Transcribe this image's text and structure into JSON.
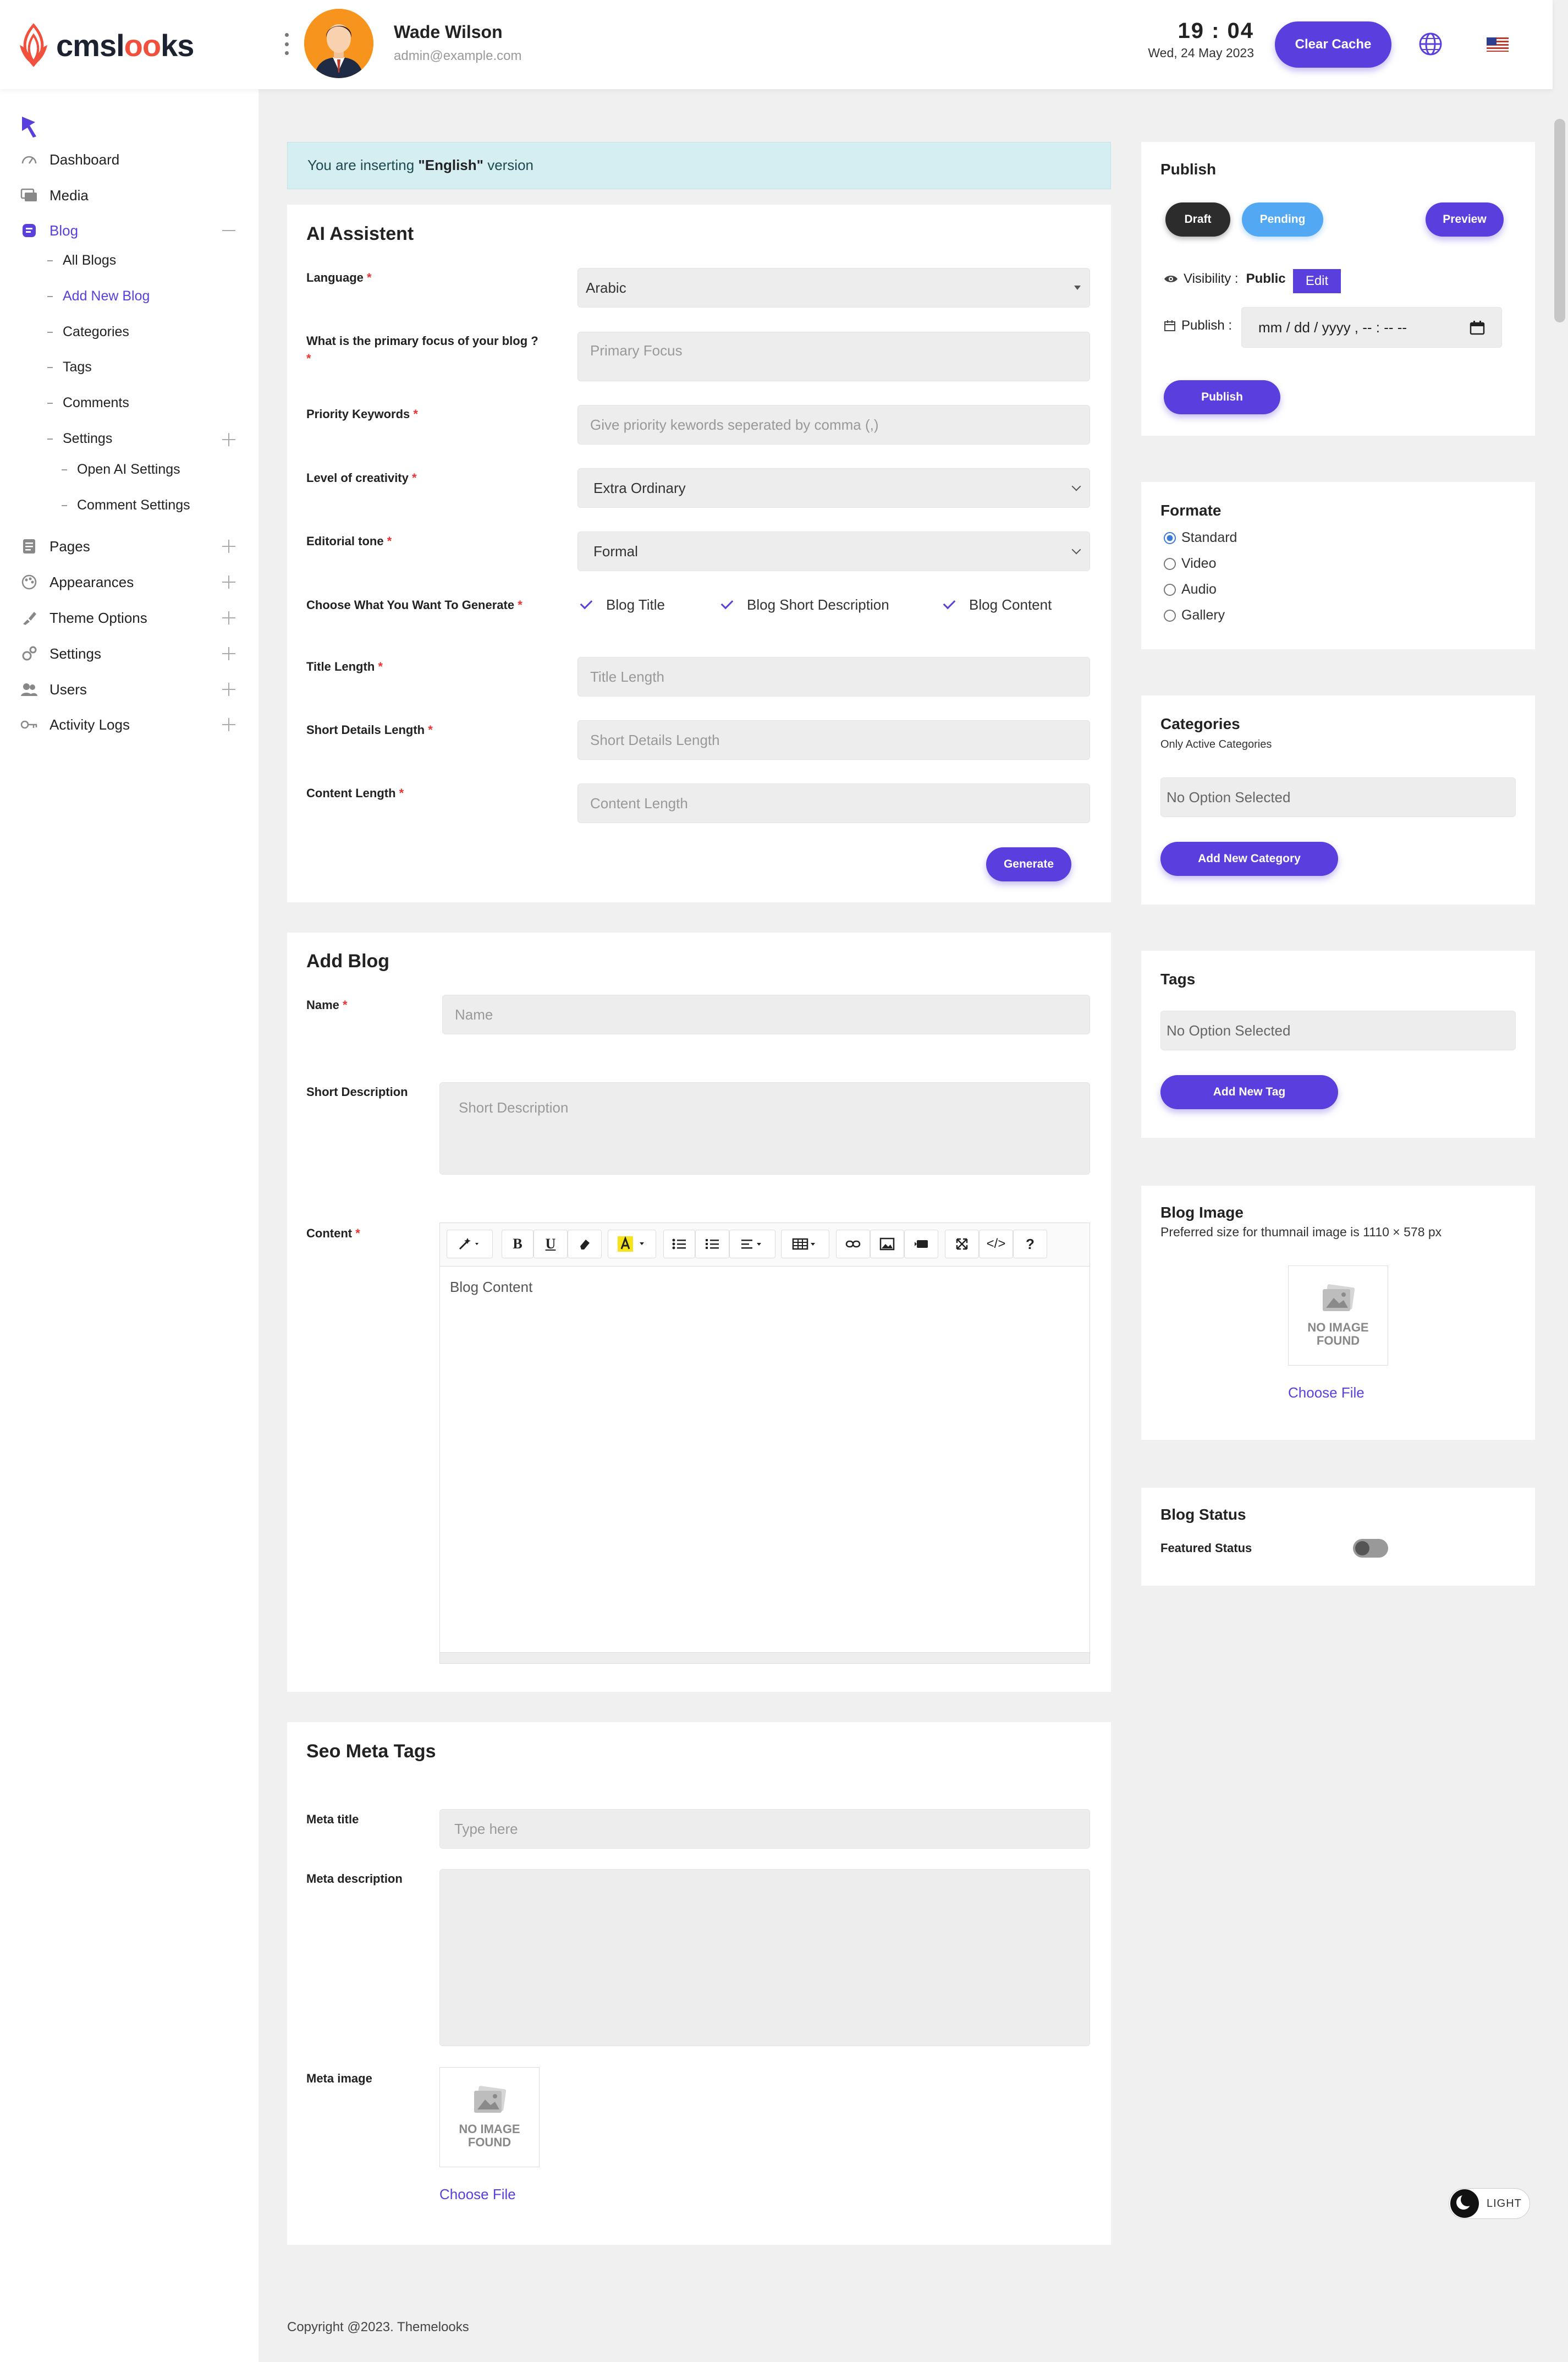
{
  "header": {
    "logo_prefix": "cmsl",
    "logo_oo": "oo",
    "logo_suffix": "ks",
    "user_name": "Wade Wilson",
    "user_email": "admin@example.com",
    "time": "19 : 04",
    "date": "Wed, 24 May 2023",
    "clear_cache_label": "Clear Cache",
    "globe_icon": "globe-icon",
    "flag_icon": "us-flag-icon"
  },
  "sidebar": {
    "items": [
      {
        "label": "Dashboard",
        "icon": "dashboard-icon"
      },
      {
        "label": "Media",
        "icon": "media-icon"
      },
      {
        "label": "Blog",
        "icon": "blog-icon"
      },
      {
        "label": "Pages",
        "icon": "pages-icon"
      },
      {
        "label": "Appearances",
        "icon": "appearances-icon"
      },
      {
        "label": "Theme Options",
        "icon": "theme-options-icon"
      },
      {
        "label": "Settings",
        "icon": "settings-icon"
      },
      {
        "label": "Users",
        "icon": "users-icon"
      },
      {
        "label": "Activity Logs",
        "icon": "activity-logs-icon"
      }
    ],
    "blog_sub": [
      "All Blogs",
      "Add New Blog",
      "Categories",
      "Tags",
      "Comments",
      "Settings"
    ],
    "settings_sub": [
      "Open AI Settings",
      "Comment Settings"
    ]
  },
  "notice": {
    "prefix": "You are inserting ",
    "lang": "\"English\"",
    "suffix": " version"
  },
  "ai": {
    "title": "AI Assistent",
    "language_label": "Language",
    "language_value": "Arabic",
    "focus_label": "What is the primary focus of your blog ?",
    "focus_placeholder": "Primary Focus",
    "keywords_label": "Priority Keywords",
    "keywords_placeholder": "Give priority kewords seperated by comma (,)",
    "creativity_label": "Level of creativity",
    "creativity_value": "Extra Ordinary",
    "tone_label": "Editorial tone",
    "tone_value": "Formal",
    "generate_what_label": "Choose What You Want To Generate",
    "checks": [
      "Blog Title",
      "Blog Short Description",
      "Blog Content"
    ],
    "title_length_label": "Title Length",
    "title_length_placeholder": "Title Length",
    "short_length_label": "Short Details Length",
    "short_length_placeholder": "Short Details Length",
    "content_length_label": "Content Length",
    "content_length_placeholder": "Content Length",
    "generate_label": "Generate",
    "required": "*"
  },
  "blog": {
    "title": "Add Blog",
    "name_label": "Name",
    "name_placeholder": "Name",
    "short_label": "Short Description",
    "short_placeholder": "Short Description",
    "content_label": "Content",
    "content_placeholder": "Blog Content",
    "toolbar": {
      "bold": "B",
      "underline": "U",
      "help": "?",
      "code": "</>"
    }
  },
  "seo": {
    "title": "Seo Meta Tags",
    "meta_title_label": "Meta title",
    "meta_title_placeholder": "Type here",
    "meta_desc_label": "Meta description",
    "meta_image_label": "Meta image",
    "no_image_line1": "NO IMAGE",
    "no_image_line2": "FOUND",
    "choose_file": "Choose File"
  },
  "publish": {
    "title": "Publish",
    "draft": "Draft",
    "pending": "Pending",
    "preview": "Preview",
    "visibility_label": "Visibility :",
    "visibility_value": "Public",
    "edit": "Edit",
    "publish_label": "Publish :",
    "date_placeholder": "mm / dd / yyyy ,  -- : --   --",
    "publish_button": "Publish"
  },
  "formate": {
    "title": "Formate",
    "options": [
      "Standard",
      "Video",
      "Audio",
      "Gallery"
    ],
    "selected": "Standard"
  },
  "categories": {
    "title": "Categories",
    "subtitle": "Only Active Categories",
    "placeholder": "No Option Selected",
    "add_button": "Add New Category"
  },
  "tags": {
    "title": "Tags",
    "placeholder": "No Option Selected",
    "add_button": "Add New Tag"
  },
  "blog_image": {
    "title": "Blog Image",
    "hint": "Preferred size for thumnail image is 1110 × 578 px",
    "no_image_line1": "NO IMAGE",
    "no_image_line2": "FOUND",
    "choose_file": "Choose File"
  },
  "blog_status": {
    "title": "Blog Status",
    "featured_label": "Featured Status",
    "featured_on": false
  },
  "theme_toggle": "LIGHT",
  "footer": "Copyright @2023. Themelooks",
  "colors": {
    "accent": "#5b3fde",
    "notice_bg": "#d4eef1",
    "pending": "#53a8f4"
  }
}
